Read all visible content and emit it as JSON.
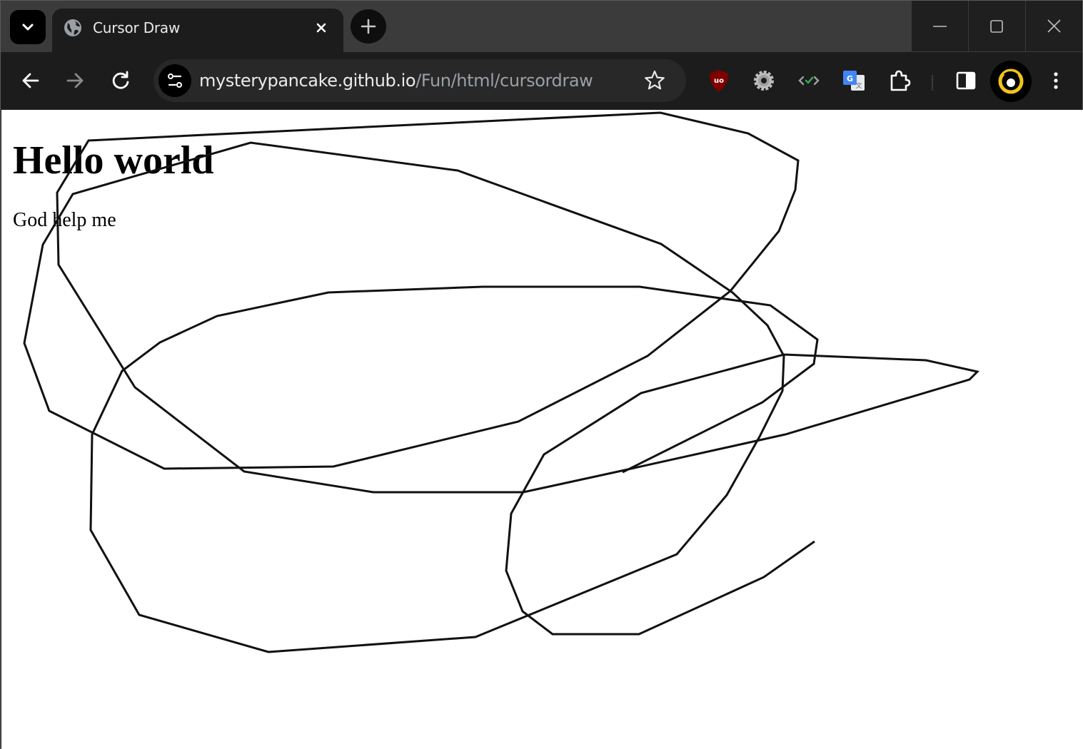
{
  "browser": {
    "tab": {
      "title": "Cursor Draw"
    },
    "address": {
      "host": "mysterypancake.github.io",
      "path": "/Fun/html/cursordraw"
    },
    "icons": {
      "tab_search": "chevron-down-icon",
      "favicon": "globe-icon",
      "tab_close": "close-icon",
      "new_tab": "plus-icon",
      "back": "back-arrow-icon",
      "forward": "forward-arrow-icon",
      "reload": "reload-icon",
      "site_info": "site-settings-icon",
      "bookmark": "star-icon",
      "extensions": [
        "ublock-origin-icon",
        "settings-gear-icon",
        "dev-tool-extension-icon",
        "google-translate-icon",
        "puzzle-extensions-icon"
      ],
      "side_panel": "side-panel-icon",
      "profile": "profile-avatar-icon",
      "menu": "kebab-menu-icon",
      "minimize": "minimize-icon",
      "maximize": "maximize-icon",
      "close_window": "window-close-icon"
    }
  },
  "page": {
    "heading": "Hello world",
    "paragraph": "God help me"
  },
  "colors": {
    "tabstrip": "#3b3b3b",
    "toolbar": "#1c1c1c",
    "omnibox": "#282828",
    "page_bg": "#ffffff",
    "stroke": "#111111",
    "ublock_red": "#800000",
    "translate_blue": "#4285f4",
    "profile_yellow": "#f0c419"
  }
}
